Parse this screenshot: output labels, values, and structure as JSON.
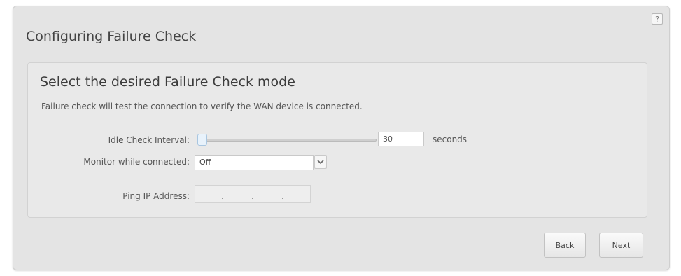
{
  "dialog": {
    "title": "Configuring Failure Check",
    "help_label": "?"
  },
  "panel": {
    "heading": "Select the desired Failure Check mode",
    "description": "Failure check will test the connection to verify the WAN device is connected."
  },
  "form": {
    "idle_interval": {
      "label": "Idle Check Interval:",
      "slider_position": 0,
      "value": "30",
      "unit": "seconds"
    },
    "monitor": {
      "label": "Monitor while connected:",
      "selected": "Off"
    },
    "ping": {
      "label": "Ping IP Address:",
      "value": "",
      "separator": "."
    }
  },
  "buttons": {
    "back": "Back",
    "next": "Next"
  }
}
